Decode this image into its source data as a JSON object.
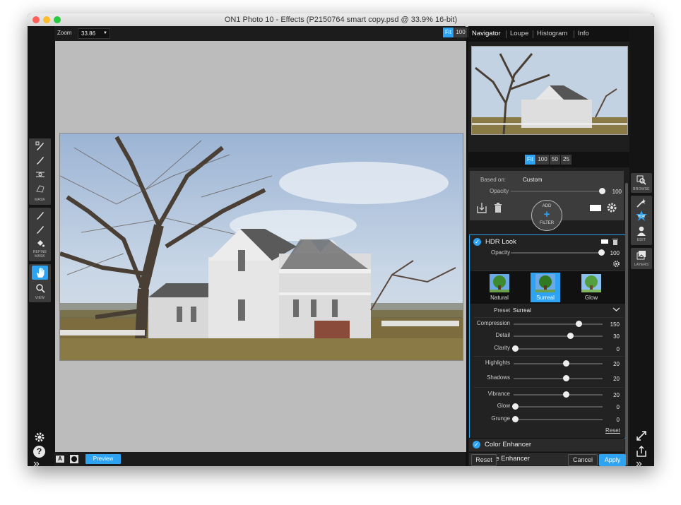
{
  "window": {
    "title": "ON1 Photo 10 - Effects (P2150764 smart copy.psd @ 33.9% 16-bit)"
  },
  "colors": {
    "accent": "#2ea3f2",
    "panel": "#1e1e1e",
    "canvas": "#bcbcbc"
  },
  "left_toolbar": {
    "mask_label": "MASK",
    "refine_label": "REFINE MASK",
    "view_label": "VIEW",
    "icons": [
      "brush-icon",
      "brush-icon",
      "gradient-icon",
      "polygon-icon",
      "brush-icon",
      "brush-icon",
      "paint-bucket-icon",
      "hand-icon",
      "zoom-icon",
      "gear-icon",
      "help-icon",
      "expand-icon"
    ]
  },
  "zoom": {
    "label": "Zoom",
    "value": "33.86",
    "buttons": [
      "Fit",
      "100",
      "50",
      "25"
    ],
    "active": "Fit"
  },
  "bottom": {
    "a_label": "A",
    "preview_label": "Preview"
  },
  "navigator": {
    "tabs": [
      "Navigator",
      "Loupe",
      "Histogram",
      "Info"
    ],
    "active_tab": "Navigator",
    "zoom_buttons": [
      "Fit",
      "100",
      "50",
      "25"
    ]
  },
  "layer_controls": {
    "based_on_label": "Based on:",
    "based_on_value": "Custom",
    "opacity_label": "Opacity",
    "opacity_value": "100",
    "add_label": "ADD",
    "filter_label": "FILTER"
  },
  "hdr": {
    "title": "HDR Look",
    "opacity_label": "Opacity",
    "opacity_value": "100",
    "presets": [
      {
        "label": "Natural",
        "selected": false
      },
      {
        "label": "Surreal",
        "selected": true
      },
      {
        "label": "Glow",
        "selected": false
      }
    ],
    "preset_label": "Preset",
    "preset_value": "Surreal",
    "sliders": [
      {
        "label": "Compression",
        "value": "150",
        "fraction": 0.75
      },
      {
        "label": "Detail",
        "value": "30",
        "fraction": 0.65
      },
      {
        "label": "Clarity",
        "value": "0",
        "fraction": 0.0
      },
      {
        "label": "Highlights",
        "value": "20",
        "fraction": 0.6
      },
      {
        "label": "Shadows",
        "value": "20",
        "fraction": 0.6
      },
      {
        "label": "Vibrance",
        "value": "20",
        "fraction": 0.6
      },
      {
        "label": "Glow",
        "value": "0",
        "fraction": 0.0
      },
      {
        "label": "Grunge",
        "value": "0",
        "fraction": 0.0
      }
    ],
    "reset_label": "Reset"
  },
  "filters": [
    {
      "title": "Color Enhancer"
    },
    {
      "title": "Tone Enhancer"
    }
  ],
  "footer": {
    "reset": "Reset",
    "cancel": "Cancel",
    "apply": "Apply"
  },
  "right_toolbar": {
    "browse_label": "BROWSE",
    "edit_label": "EDIT",
    "layers_label": "LAYERS"
  }
}
